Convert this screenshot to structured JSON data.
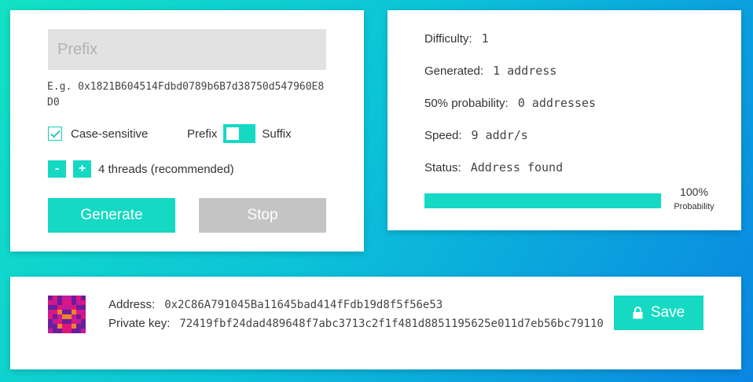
{
  "input_panel": {
    "prefix_placeholder": "Prefix",
    "example_text": "E.g. 0x1821B604514Fdbd0789b6B7d38750d547960E8D0",
    "case_sensitive_label": "Case-sensitive",
    "case_sensitive_checked": true,
    "prefix_label": "Prefix",
    "suffix_label": "Suffix",
    "decrement_label": "-",
    "increment_label": "+",
    "threads_label": "4 threads (recommended)",
    "generate_label": "Generate",
    "stop_label": "Stop"
  },
  "stats": {
    "difficulty_label": "Difficulty:",
    "difficulty_value": "1",
    "generated_label": "Generated:",
    "generated_value": "1 address",
    "probability_label": "50% probability:",
    "probability_value": "0 addresses",
    "speed_label": "Speed:",
    "speed_value": "9 addr/s",
    "status_label": "Status:",
    "status_value": "Address found",
    "progress_percent": "100%",
    "progress_fraction": 1.0,
    "progress_caption": "Probability"
  },
  "result": {
    "address_label": "Address:",
    "address_value": "0x2C86A791045Ba11645bad414fFdb19d8f5f56e53",
    "private_key_label": "Private key:",
    "private_key_value": "72419fbf24dad489648f7abc3713c2f1f481d8851195625e011d7eb56bc79110",
    "save_label": "Save"
  },
  "colors": {
    "accent": "#15d9c3",
    "disabled": "#c4c4c4"
  },
  "icons": {
    "checkbox": "check-icon",
    "save": "lock-icon"
  }
}
